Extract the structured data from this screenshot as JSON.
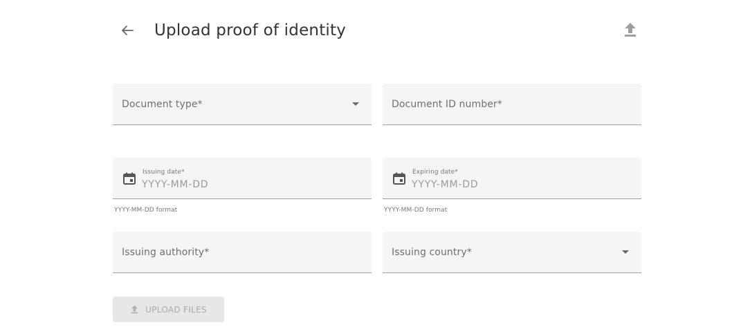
{
  "header": {
    "title": "Upload proof of identity"
  },
  "form": {
    "document_type": {
      "label": "Document type*"
    },
    "document_id": {
      "label": "Document ID number*"
    },
    "issuing_date": {
      "label": "Issuing date*",
      "placeholder": "YYYY-MM-DD",
      "hint": "YYYY-MM-DD format"
    },
    "expiring_date": {
      "label": "Expiring date*",
      "placeholder": "YYYY-MM-DD",
      "hint": "YYYY-MM-DD format"
    },
    "issuing_authority": {
      "label": "Issuing authority*"
    },
    "issuing_country": {
      "label": "Issuing country*"
    }
  },
  "actions": {
    "upload_files_label": "UPLOAD FILES"
  },
  "icons": {
    "back": "arrow-left-icon",
    "upload": "upload-icon",
    "calendar": "calendar-icon",
    "dropdown": "caret-down-icon"
  },
  "colors": {
    "field_bg": "#f5f5f5",
    "field_underline": "#9e9e9e",
    "disabled_button_bg": "#e7e7e7",
    "disabled_text": "#ababab"
  }
}
